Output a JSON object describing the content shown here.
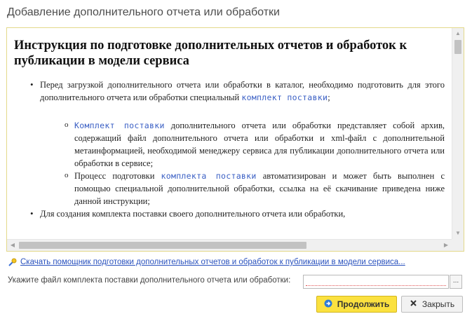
{
  "window": {
    "title": "Добавление  дополнительного отчета или обработки"
  },
  "document": {
    "heading": "Инструкция по подготовке дополнительных отчетов и обработок к публикации в модели сервиса",
    "bullet1_text": "Перед загрузкой дополнительного отчета или обработки в каталог, необходимо подготовить для этого дополнительного отчета или обработки специальный ",
    "bullet1_link": "комплект поставки",
    "bullet1_end": ";",
    "sub1_link": "Комплект поставки",
    "sub1_text": " дополнительного отчета или обработки представляет собой архив, содержащий файл дополнительного отчета или обработки и xml-файл с дополнительной метаинформацией, необходимой менеджеру сервиса для публикации дополнительного отчета или обработки в сервисе;",
    "sub2_text_a": "Процесс подготовки ",
    "sub2_link": "комплекта поставки",
    "sub2_text_b": " автоматизирован и может быть выполнен с помощью специальной дополнительной обработки, ссылка на её скачивание приведена ниже данной инструкции;",
    "bullet2_text": "Для создания комплекта поставки своего дополнительного отчета или обработки,"
  },
  "helper_link": "Скачать помощник подготовки дополнительных отчетов и обработок к публикации в модели сервиса...",
  "file_field": {
    "label": "Укажите файл комплекта поставки дополнительного отчета или обработки:",
    "value": "",
    "select_button": "..."
  },
  "buttons": {
    "continue": "Продолжить",
    "close": "Закрыть"
  },
  "colors": {
    "primary_button": "#fbe13f",
    "frame_border": "#e3d98a",
    "link": "#2a52be"
  },
  "icons": [
    "download-helper-icon",
    "arrow-right-icon",
    "close-x-icon"
  ]
}
